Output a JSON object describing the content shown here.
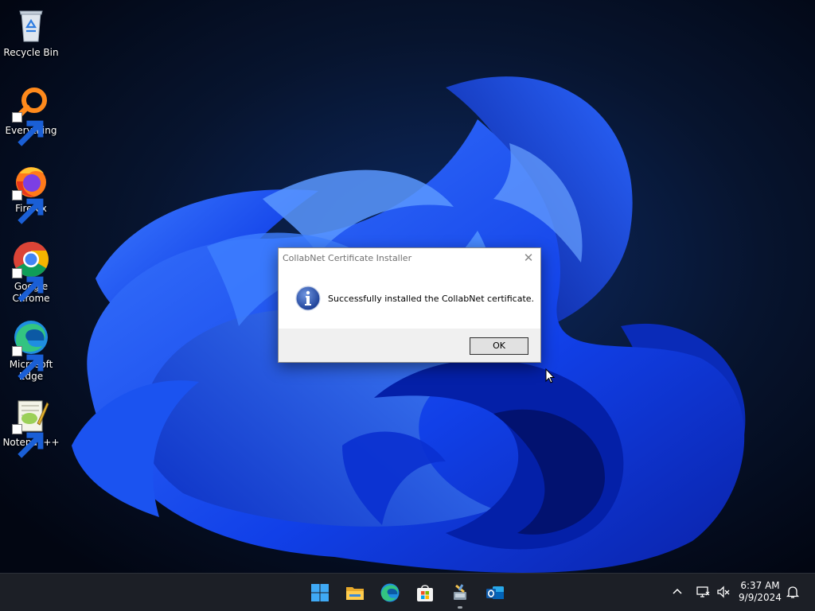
{
  "desktop": {
    "icons": [
      {
        "label": "Recycle Bin",
        "icon": "recycle-bin-icon"
      },
      {
        "label": "Everything",
        "icon": "everything-search-icon"
      },
      {
        "label": "Firefox",
        "icon": "firefox-icon"
      },
      {
        "label": "Google Chrome",
        "icon": "chrome-icon"
      },
      {
        "label": "Microsoft Edge",
        "icon": "edge-icon"
      },
      {
        "label": "Notepad++",
        "icon": "notepad-plus-plus-icon"
      }
    ]
  },
  "dialog": {
    "title": "CollabNet Certificate Installer",
    "close_symbol": "✕",
    "icon": "info-icon",
    "message": "Successfully installed the CollabNet certificate.",
    "ok_label": "OK"
  },
  "taskbar": {
    "apps": [
      {
        "name": "start",
        "icon": "windows-start-icon"
      },
      {
        "name": "file-explorer",
        "icon": "folder-icon"
      },
      {
        "name": "edge",
        "icon": "edge-icon"
      },
      {
        "name": "microsoft-store",
        "icon": "store-icon"
      },
      {
        "name": "installer",
        "icon": "installer-icon",
        "running": true
      },
      {
        "name": "outlook",
        "icon": "outlook-icon"
      }
    ],
    "tray": {
      "icons": [
        "chevron-up-icon",
        "network-icon",
        "volume-muted-icon",
        "notification-bell-icon"
      ],
      "time": "6:37 AM",
      "date": "9/9/2024"
    }
  },
  "colors": {
    "taskbar_bg": "#1c1f26",
    "wallpaper_blue": "#1a4cff",
    "dialog_bg": "#f0f0f0"
  }
}
